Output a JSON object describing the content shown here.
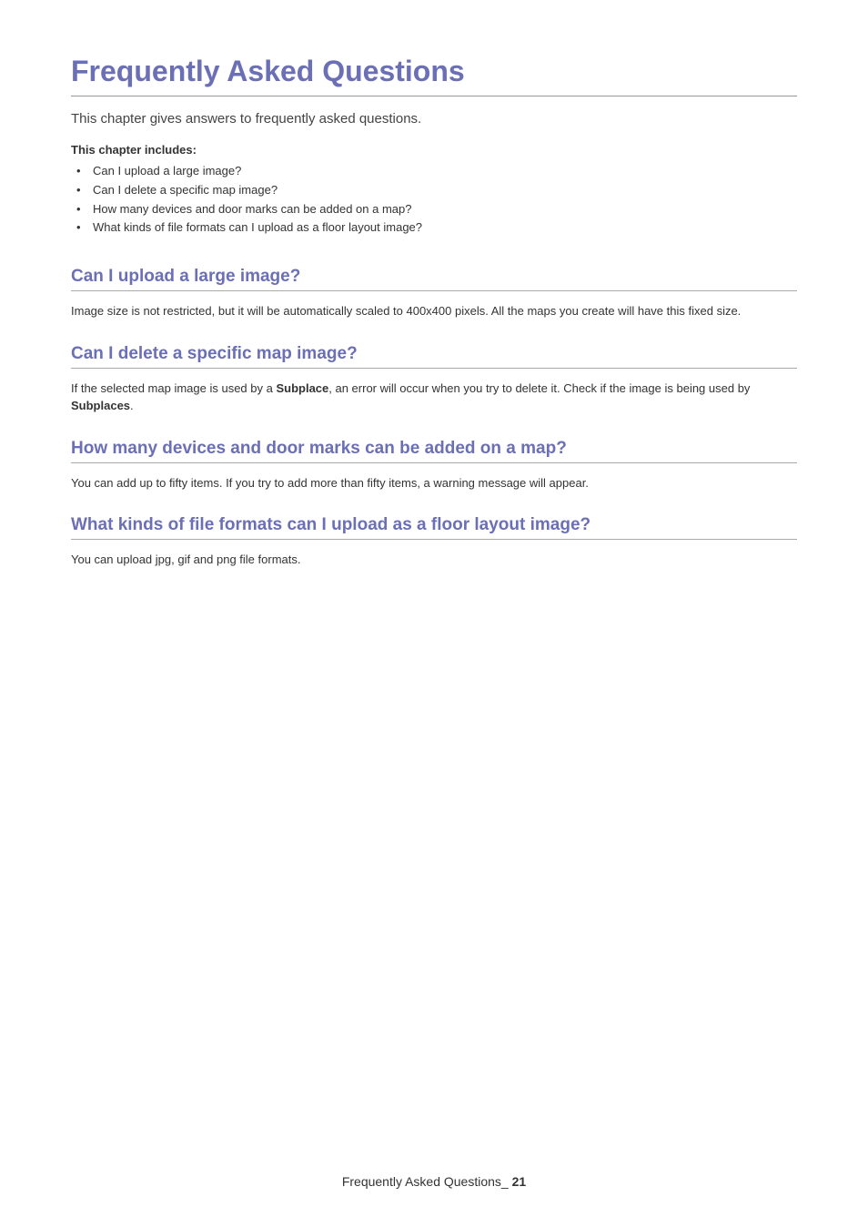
{
  "title": "Frequently Asked Questions",
  "intro": "This chapter gives answers to frequently asked questions.",
  "includes_label": "This chapter includes:",
  "includes": [
    "Can I upload a large image?",
    "Can I delete a specific map image?",
    "How many devices and door marks can be added on a map?",
    "What kinds of file formats can I upload as a floor layout image?"
  ],
  "sections": [
    {
      "heading": "Can I upload a large image?",
      "body_html": "Image size is not restricted, but it will be automatically scaled to 400x400 pixels. All the maps you create will have this fixed size."
    },
    {
      "heading": "Can I delete a specific map image?",
      "body_html": "If the selected map image is used by a <b>Subplace</b>, an error will occur when you try to delete it. Check if the image is being used by <b>Subplaces</b>."
    },
    {
      "heading": "How many devices and door marks can be added on a map?",
      "body_html": "You can add up to fifty items. If you try to add more than fifty items, a warning message will appear."
    },
    {
      "heading": "What kinds of file formats can I upload as a floor layout image?",
      "body_html": "You can upload jpg, gif and png file formats."
    }
  ],
  "footer": {
    "label": "Frequently Asked Questions_",
    "page": "21"
  }
}
